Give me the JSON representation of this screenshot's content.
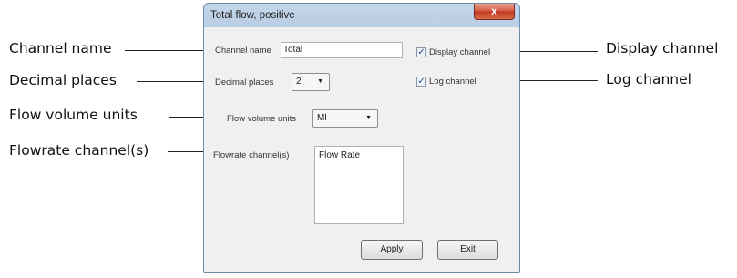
{
  "callouts": {
    "channel_name": "Channel name",
    "decimal_places": "Decimal places",
    "flow_volume_units": "Flow volume units",
    "flowrate_channels": "Flowrate channel(s)",
    "display_channel": "Display channel",
    "log_channel": "Log channel"
  },
  "dialog": {
    "title": "Total flow, positive",
    "close_glyph": "x",
    "channel_name_label": "Channel name",
    "channel_name_value": "Total",
    "decimal_places_label": "Decimal places",
    "decimal_places_value": "2",
    "flow_volume_units_label": "Flow volume units",
    "flow_volume_units_value": "Ml",
    "flowrate_channels_label": "Flowrate channel(s)",
    "flowrate_channels_items": [
      "Flow Rate"
    ],
    "display_channel_label": "Display channel",
    "display_channel_checked": true,
    "log_channel_label": "Log channel",
    "log_channel_checked": true,
    "apply_label": "Apply",
    "exit_label": "Exit",
    "check_glyph": "✓",
    "dropdown_glyph": "▼"
  }
}
